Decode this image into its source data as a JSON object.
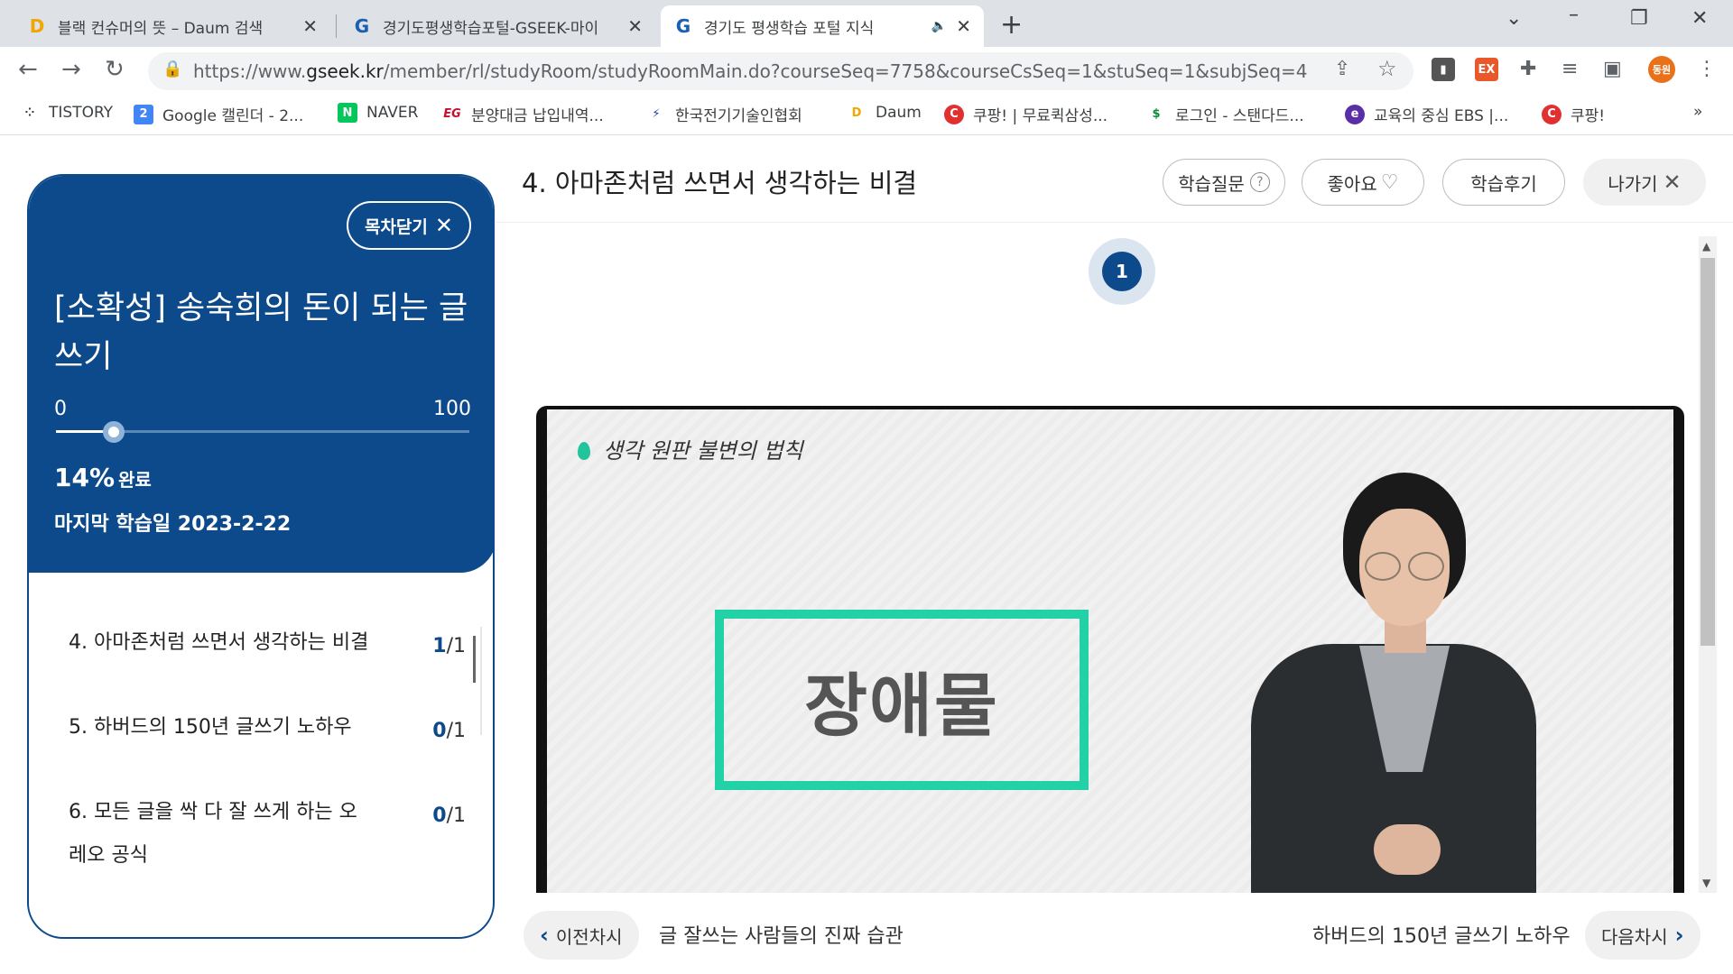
{
  "browser": {
    "tabs": [
      {
        "title": "블랙 컨슈머의 뜻 – Daum 검색",
        "icon": "daum-icon"
      },
      {
        "title": "경기도평생학습포털-GSEEK-마이",
        "icon": "gseek-icon"
      },
      {
        "title": "경기도 평생학습 포털 지식",
        "icon": "gseek-icon"
      }
    ],
    "url_prefix": "https://www.",
    "url_host": "gseek.kr",
    "url_path": "/member/rl/studyRoom/studyRoomMain.do?courseSeq=7758&courseCsSeq=1&stuSeq=1&subjSeq=4",
    "profile_label": "동원",
    "ext_label": "EX",
    "bookmarks": [
      "TISTORY",
      "Google 캘린더 - 2...",
      "NAVER",
      "분양대금 납입내역...",
      "한국전기기술인협회",
      "Daum",
      "쿠팡! | 무료퀵삼성...",
      "로그인 - 스탠다드...",
      "교육의 중심 EBS |...",
      "쿠팡!"
    ],
    "more_bookmarks": "»"
  },
  "sidebar": {
    "close_label": "목차닫기",
    "course_title": "[소확성] 송숙희의 돈이 되는 글쓰기",
    "progress_min": "0",
    "progress_max": "100",
    "progress_value": 14,
    "percent_text": "14%",
    "percent_suffix": "완료",
    "last_study": "마지막 학습일 2023-2-22",
    "lessons": [
      {
        "title": "4. 아마존처럼 쓰면서 생각하는 비결",
        "done": "1",
        "total": "/1"
      },
      {
        "title": "5. 하버드의 150년 글쓰기 노하우",
        "done": "0",
        "total": "/1"
      },
      {
        "title": "6. 모든 글을 싹 다 잘 쓰게 하는 오레오 공식",
        "done": "0",
        "total": "/1"
      }
    ]
  },
  "main": {
    "lesson_title": "4. 아마존처럼 쓰면서 생각하는 비결",
    "buttons": {
      "question": "학습질문",
      "like": "좋아요",
      "review": "학습후기",
      "exit": "나가기"
    },
    "step": "1",
    "video": {
      "handwriting": "생각 원판 불변의 법칙",
      "box_word": "장애물"
    },
    "prev_label": "이전차시",
    "prev_title": "글 잘쓰는 사람들의 진짜 습관",
    "next_title": "하버드의 150년 글쓰기 노하우",
    "next_label": "다음차시"
  },
  "colors": {
    "brand": "#0d4a8c",
    "accent_green": "#22d1a6"
  }
}
